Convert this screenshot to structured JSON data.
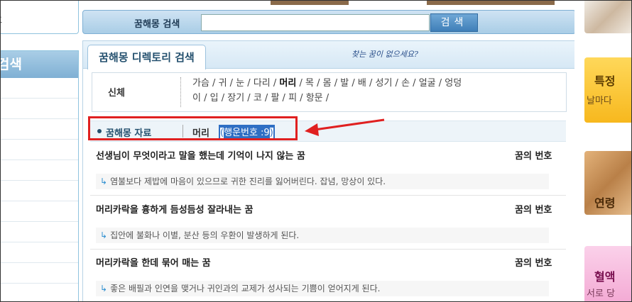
{
  "sidebar": {
    "top_fragment": "호",
    "menu_head": "검색"
  },
  "search": {
    "label": "꿈해몽 검색",
    "placeholder": "",
    "button": "검색"
  },
  "directory": {
    "tab_title": "꿈해몽 디렉토리 검색",
    "hint": "찾는 꿈이 없으세요?",
    "category_label": "신체",
    "categories_line1": [
      "가슴",
      "귀",
      "눈",
      "다리",
      "머리",
      "목",
      "몸",
      "발",
      "배",
      "성기",
      "손",
      "얼굴",
      "엉덩"
    ],
    "categories_line2": [
      "이",
      "입",
      "장기",
      "코",
      "팔",
      "피",
      "항문"
    ],
    "selected_category": "머리"
  },
  "data_bar": {
    "title": "꿈해몽 자료",
    "section": "머리",
    "count_open": "(",
    "count_text": "행운번호 :9",
    "count_close": ")"
  },
  "items": [
    {
      "title": "선생님이 무엇이라고 말을 했는데 기억이 나지 않는 꿈",
      "tag": "꿈의 번호",
      "desc": "염불보다 제밥에 마음이 있으므로 귀한 진리를 잃어버린다. 잡념, 망상이 있다."
    },
    {
      "title": "머리카락을 흉하게 듬성듬성 잘라내는 꿈",
      "tag": "꿈의 번호",
      "desc": "집안에 불화나 이별, 분산 등의 우환이 발생하게 된다."
    },
    {
      "title": "머리카락을 한데 묶어 매는 꿈",
      "tag": "꿈의 번호",
      "desc": "좋은 배필과 인연을 맺거나 귀인과의 교제가 성사되는 기쁨이 얻어지게 된다."
    }
  ],
  "ads": {
    "ad2_title": "특정",
    "ad2_sub": "날마다",
    "ad3_title": "연령",
    "ad4_title": "혈액",
    "ad4_sub": "서로 당"
  },
  "colors": {
    "highlight_box": "#e02020",
    "accent_blue": "#24506e",
    "selection": "#2f6fc4"
  }
}
